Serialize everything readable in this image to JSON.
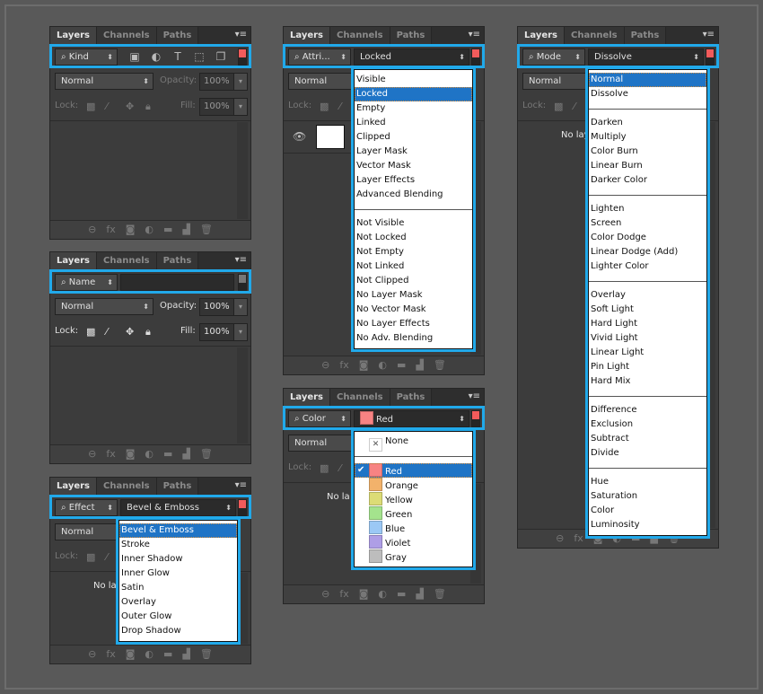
{
  "tabs": [
    "Layers",
    "Channels",
    "Paths"
  ],
  "panel_menu_icon": "panel-menu-icon",
  "accent": "#21a9ea",
  "panels": [
    {
      "filter_kind": "Kind",
      "filter_icons": [
        "image-filter-icon",
        "adjustment-filter-icon",
        "type-filter-icon",
        "shape-filter-icon",
        "smart-object-filter-icon"
      ],
      "toggle_on": true,
      "blend": "Normal",
      "opacity_label": "Opacity:",
      "opacity": "100%",
      "lock_label": "Lock:",
      "fill_label": "Fill:",
      "fill": "100%",
      "active": false
    },
    {
      "filter_kind": "Name",
      "value": "",
      "toggle_on": false,
      "blend": "Normal",
      "opacity_label": "Opacity:",
      "opacity": "100%",
      "lock_label": "Lock:",
      "fill_label": "Fill:",
      "fill": "100%",
      "active": true
    },
    {
      "filter_kind": "Effect",
      "value": "Bevel & Emboss",
      "toggle_on": true,
      "blend": "Normal",
      "lock_label": "Lock:",
      "empty_text": "No lay",
      "active": false,
      "dropdown": {
        "selected": 0,
        "items": [
          "Bevel & Emboss",
          "Stroke",
          "Inner Shadow",
          "Inner Glow",
          "Satin",
          "Overlay",
          "Outer Glow",
          "Drop Shadow"
        ]
      }
    },
    {
      "filter_kind": "Attri...",
      "value": "Locked",
      "toggle_on": true,
      "blend": "Normal",
      "lock_label": "Lock:",
      "has_layer": true,
      "active": false,
      "dropdown": {
        "selected": 1,
        "items": [
          "Visible",
          "Locked",
          "Empty",
          "Linked",
          "Clipped",
          "Layer Mask",
          "Vector Mask",
          "Layer Effects",
          "Advanced Blending",
          "-",
          "Not Visible",
          "Not Locked",
          "Not Empty",
          "Not Linked",
          "Not Clipped",
          "No Layer Mask",
          "No Vector Mask",
          "No Layer Effects",
          "No Adv. Blending"
        ]
      }
    },
    {
      "filter_kind": "Color",
      "value": "Red",
      "value_color": "#f78383",
      "toggle_on": true,
      "blend": "Normal",
      "lock_label": "Lock:",
      "empty_text": "No la",
      "active": false,
      "dropdown": {
        "selected": 2,
        "items": [
          {
            "label": "None",
            "icon": "none-icon"
          },
          "-",
          {
            "label": "Red",
            "color": "#f78383",
            "checked": true
          },
          {
            "label": "Orange",
            "color": "#f2b26b"
          },
          {
            "label": "Yellow",
            "color": "#dcdc76"
          },
          {
            "label": "Green",
            "color": "#a4e38d"
          },
          {
            "label": "Blue",
            "color": "#9bc8f5"
          },
          {
            "label": "Violet",
            "color": "#ae9ee6"
          },
          {
            "label": "Gray",
            "color": "#bdbdbd"
          }
        ]
      }
    },
    {
      "filter_kind": "Mode",
      "value": "Dissolve",
      "toggle_on": true,
      "blend": "Normal",
      "lock_label": "Lock:",
      "empty_text": "No lay",
      "active": false,
      "dropdown": {
        "selected": 0,
        "items": [
          "Normal",
          "Dissolve",
          "-",
          "Darken",
          "Multiply",
          "Color Burn",
          "Linear Burn",
          "Darker Color",
          "-",
          "Lighten",
          "Screen",
          "Color Dodge",
          "Linear Dodge (Add)",
          "Lighter Color",
          "-",
          "Overlay",
          "Soft Light",
          "Hard Light",
          "Vivid Light",
          "Linear Light",
          "Pin Light",
          "Hard Mix",
          "-",
          "Difference",
          "Exclusion",
          "Subtract",
          "Divide",
          "-",
          "Hue",
          "Saturation",
          "Color",
          "Luminosity"
        ]
      }
    }
  ]
}
